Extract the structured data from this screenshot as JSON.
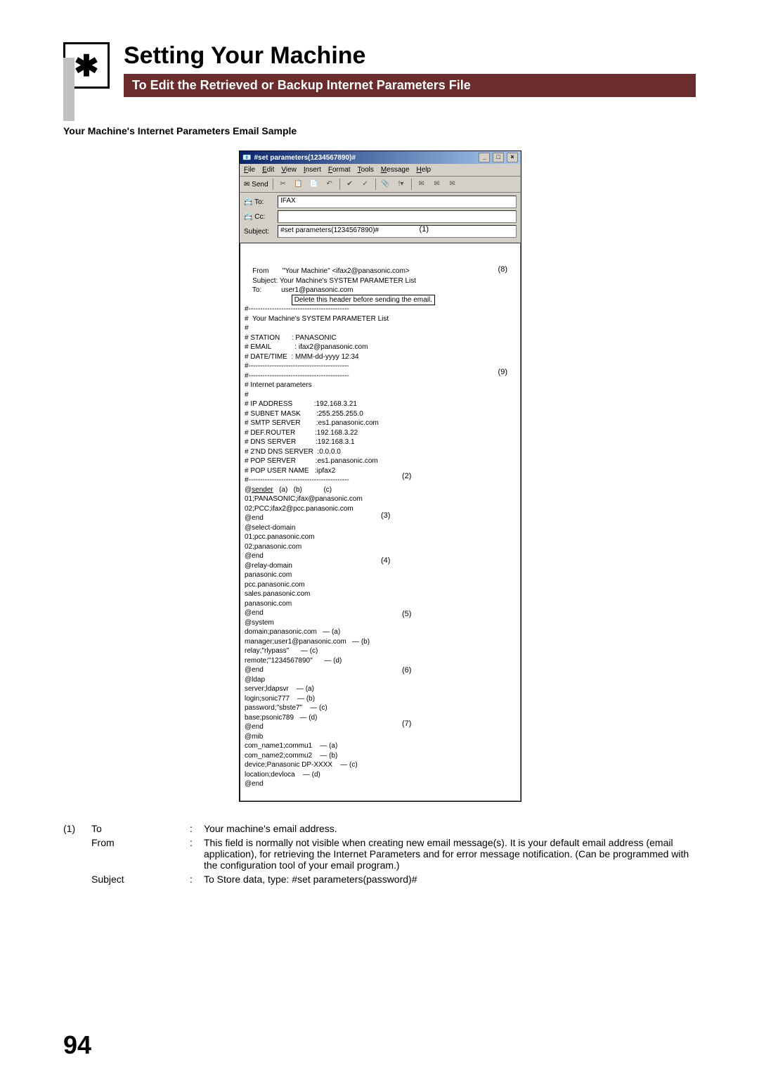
{
  "header": {
    "title": "Setting Your Machine",
    "subtitle": "To Edit the Retrieved or Backup Internet Parameters File",
    "icon_glyph": "✱"
  },
  "sample_label": "Your Machine's Internet Parameters Email Sample",
  "window": {
    "title": "#set parameters(1234567890)#",
    "menu": [
      "File",
      "Edit",
      "View",
      "Insert",
      "Format",
      "Tools",
      "Message",
      "Help"
    ],
    "send_label": "Send",
    "fields": {
      "to_label": "To:",
      "to_value": "IFAX",
      "cc_label": "Cc:",
      "cc_value": "",
      "subject_label": "Subject:",
      "subject_value": "#set parameters(1234567890)#"
    },
    "body_header": {
      "from": "\"Your Machine\" <ifax2@panasonic.com>",
      "subject": "Your Machine's SYSTEM PARAMETER List",
      "to": "user1@panasonic.com",
      "note": "Delete this header before sending the email."
    },
    "body_params": {
      "list_title": "#  Your Machine's SYSTEM PARAMETER List",
      "station": "PANASONIC",
      "email": "ifax2@panasonic.com",
      "datetime": "MMM-dd-yyyy 12:34",
      "ip_address": "192.168.3.21",
      "subnet_mask": "255.255.255.0",
      "smtp_server": "es1.panasonic.com",
      "def_router": "192.168.3.22",
      "dns_server": "192.168.3.1",
      "dns_server2": "0.0.0.0",
      "pop_server": "es1.panasonic.com",
      "pop_user": "ipfax2"
    },
    "sections": {
      "sender": [
        "01;PANASONIC;ifax@panasonic.com",
        "02;PCC;ifax2@pcc.panasonic.com"
      ],
      "select_domain": [
        "01;pcc.panasonic.com",
        "02;panasonic.com"
      ],
      "relay_domain": [
        "panasonic.com",
        "pcc.panasonic.com",
        "sales.panasonic.com",
        "panasonic.com"
      ],
      "system": [
        "domain;panasonic.com",
        "manager;user1@panasonic.com",
        "relay;\"rlypass\"",
        "remote;\"1234567890\""
      ],
      "ldap": [
        "server;ldapsvr",
        "login;sonic777",
        "password;\"sbste7\"",
        "base;psonic789"
      ],
      "mib": [
        "com_name1;commu1",
        "com_name2;commu2",
        "device;Panasonic DP-XXXX",
        "location;devloca"
      ]
    },
    "callouts": {
      "c1": "(1)",
      "c2": "(2)",
      "c3": "(3)",
      "c4": "(4)",
      "c5": "(5)",
      "c6": "(6)",
      "c7": "(7)",
      "c8": "(8)",
      "c9": "(9)",
      "la": "(a)",
      "lb": "(b)",
      "lc": "(c)",
      "ld": "(d)"
    }
  },
  "legend": [
    {
      "num": "(1)",
      "label": "To",
      "desc": "Your machine's email address."
    },
    {
      "num": "",
      "label": "From",
      "desc": "This field is normally not visible when creating new email message(s). It is your default email address (email application), for retrieving the Internet Parameters and for error message notification. (Can be programmed with the configuration tool of your email program.)"
    },
    {
      "num": "",
      "label": "Subject",
      "desc": "To Store data, type: #set parameters(password)#"
    }
  ],
  "page_number": "94"
}
